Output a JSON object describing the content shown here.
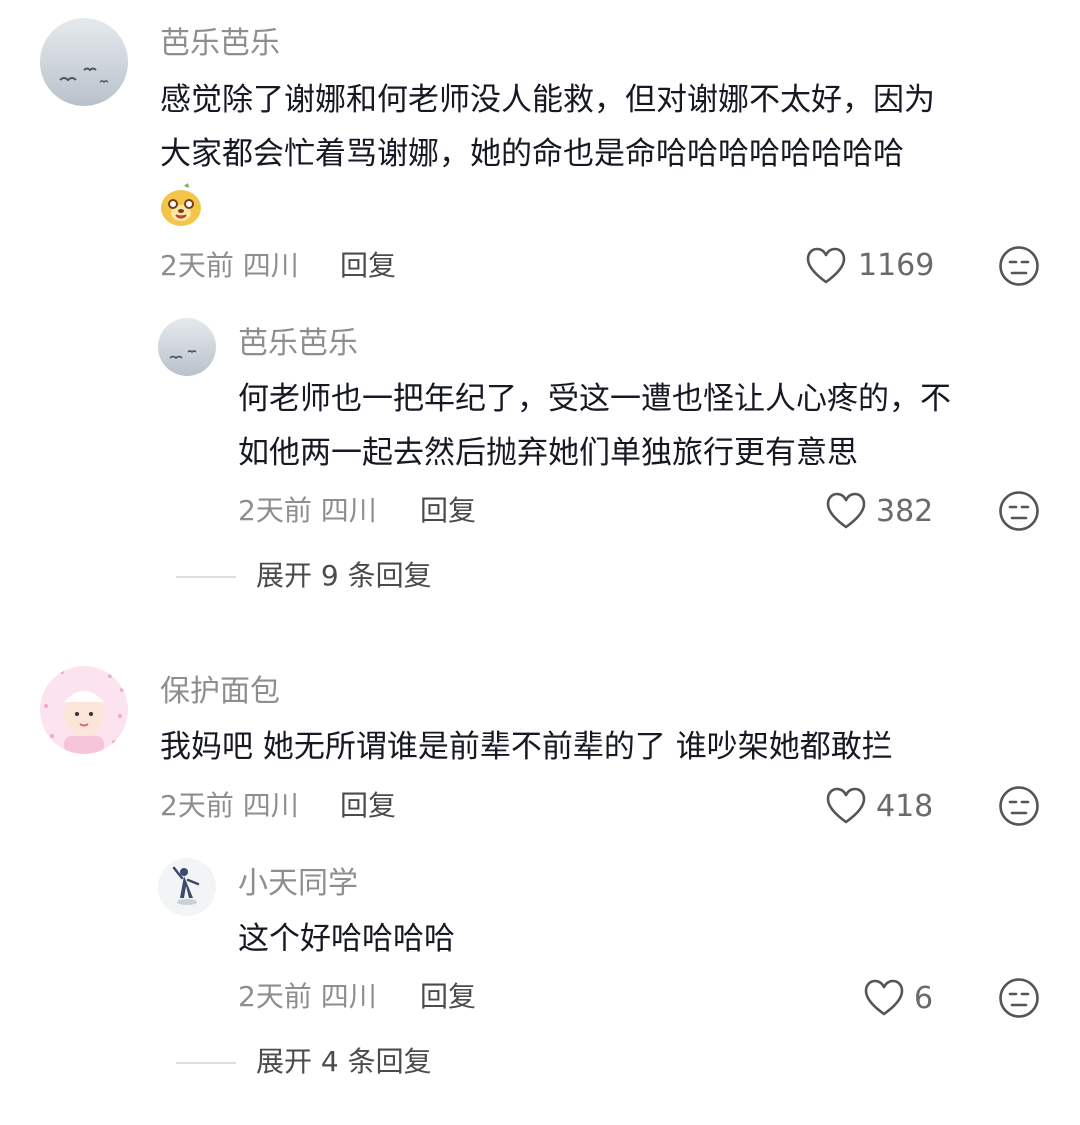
{
  "comments": [
    {
      "user": "芭乐芭乐",
      "lines": [
        "感觉除了谢娜和何老师没人能救，但对谢娜不太好，因为",
        "大家都会忙着骂谢娜，她的命也是命哈哈哈哈哈哈哈哈"
      ],
      "emoji": "doge-emoji",
      "meta": "2天前 四川",
      "reply_label": "回复",
      "likes": "1169",
      "replies": [
        {
          "user": "芭乐芭乐",
          "lines": [
            "何老师也一把年纪了，受这一遭也怪让人心疼的，不",
            "如他两一起去然后抛弃她们单独旅行更有意思"
          ],
          "meta": "2天前 四川",
          "reply_label": "回复",
          "likes": "382"
        }
      ],
      "expand_label": "展开 9 条回复"
    },
    {
      "user": "保护面包",
      "lines": [
        "我妈吧 她无所谓谁是前辈不前辈的了 谁吵架她都敢拦"
      ],
      "meta": "2天前 四川",
      "reply_label": "回复",
      "likes": "418",
      "replies": [
        {
          "user": "小天同学",
          "lines": [
            "这个好哈哈哈哈"
          ],
          "meta": "2天前 四川",
          "reply_label": "回复",
          "likes": "6"
        }
      ],
      "expand_label": "展开 4 条回复"
    }
  ],
  "icons": {
    "like": "heart-outline-icon",
    "dislike": "meh-face-icon"
  },
  "colors": {
    "text": "#161823",
    "secondary": "#8e8e8e",
    "background": "#ffffff"
  }
}
